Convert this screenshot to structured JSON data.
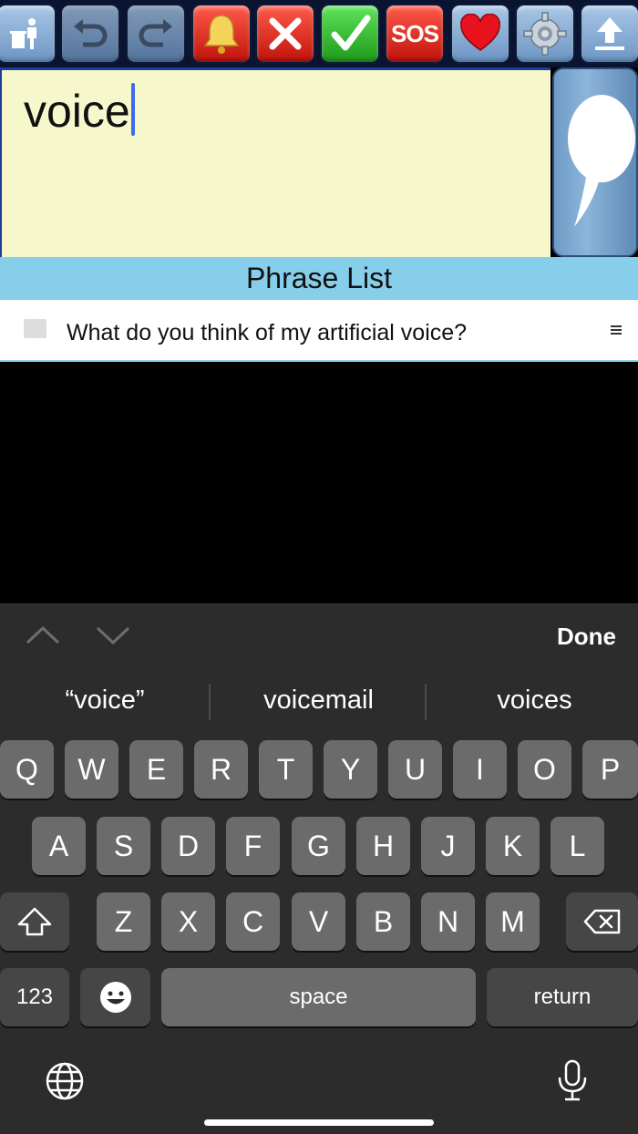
{
  "toolbar": {
    "buttons": [
      {
        "name": "trash-button",
        "icon": "trash-person-icon"
      },
      {
        "name": "undo-button",
        "icon": "undo-arrow-icon"
      },
      {
        "name": "redo-button",
        "icon": "redo-arrow-icon"
      },
      {
        "name": "bell-button",
        "icon": "bell-icon"
      },
      {
        "name": "no-button",
        "icon": "x-icon"
      },
      {
        "name": "yes-button",
        "icon": "checkmark-icon"
      },
      {
        "name": "sos-button",
        "label": "SOS"
      },
      {
        "name": "favorites-button",
        "icon": "heart-icon"
      },
      {
        "name": "settings-button",
        "icon": "gear-icon"
      },
      {
        "name": "share-button",
        "icon": "upload-arrow-icon"
      }
    ],
    "sos_label": "SOS"
  },
  "editor": {
    "text": "voice"
  },
  "speak_button": {
    "icon": "speech-bubble-icon"
  },
  "phrase_list": {
    "header": "Phrase List",
    "items": [
      {
        "text": "What do you think of my artificial voice?",
        "checked": false
      }
    ]
  },
  "keyboard": {
    "done_label": "Done",
    "suggestions": [
      "“voice”",
      "voicemail",
      "voices"
    ],
    "row1": [
      "Q",
      "W",
      "E",
      "R",
      "T",
      "Y",
      "U",
      "I",
      "O",
      "P"
    ],
    "row2": [
      "A",
      "S",
      "D",
      "F",
      "G",
      "H",
      "J",
      "K",
      "L"
    ],
    "row3": [
      "Z",
      "X",
      "C",
      "V",
      "B",
      "N",
      "M"
    ],
    "numbers_label": "123",
    "space_label": "space",
    "return_label": "return"
  },
  "colors": {
    "editor_bg": "#f7f7cc",
    "phrase_header_bg": "#87ceeb",
    "keyboard_bg": "#2c2c2c",
    "key_bg": "#6b6b6b",
    "caret": "#3b6cf0"
  }
}
